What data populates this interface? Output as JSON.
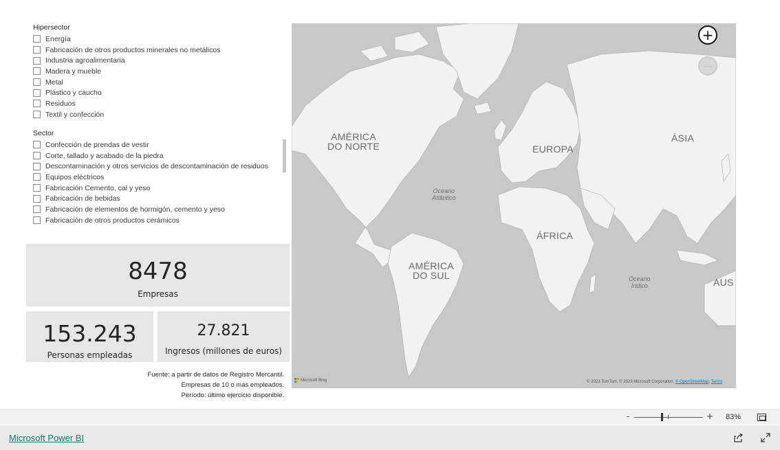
{
  "slicers": {
    "hipersector": {
      "title": "Hipersector",
      "items": [
        "Energía",
        "Fabricación de otros productos minerales no metálicos",
        "Industria agroalimentaria",
        "Madera y mueble",
        "Metal",
        "Plástico y caucho",
        "Residuos",
        "Textil y confección"
      ]
    },
    "sector": {
      "title": "Sector",
      "items": [
        "Confección de prendas de vestir",
        "Corte, tallado y acabado de la piedra",
        "Descontaminación y otros servicios de descontaminación de residuos",
        "Equipos eléctricos",
        "Fabricación Cemento, cal y yeso",
        "Fabricación de bebidas",
        "Fabricación de elementos de hormigón, cemento y yeso",
        "Fabricación de otros productos cerámicos"
      ]
    }
  },
  "kpis": {
    "empresas": {
      "value": "8478",
      "label": "Empresas"
    },
    "personas": {
      "value": "153.243",
      "label": "Personas empleadas"
    },
    "ingresos": {
      "value": "27.821",
      "label": "Ingresos (millones de euros)"
    }
  },
  "source_note": {
    "line1": "Fuente: a partir de datos de Registro Mercantil.",
    "line2": "Empresas de 10 o más empleados.",
    "line3": "Período: último ejercicio disponible."
  },
  "map": {
    "labels": {
      "north_america_1": "AMÉRICA",
      "north_america_2": "DO NORTE",
      "europe": "EUROPA",
      "asia": "ÁSIA",
      "africa": "ÁFRICA",
      "south_america_1": "AMÉRICA",
      "south_america_2": "DO SUL",
      "aus": "AUS",
      "atlantic_1": "Oceano",
      "atlantic_2": "Atlântico",
      "indian_1": "Oceano",
      "indian_2": "Índico"
    },
    "zoom_in": "+",
    "zoom_out": "−",
    "bing": "Microsoft Bing",
    "copyright": "© 2023 TomTom, © 2023 Microsoft Corporation,",
    "osm_link": "© OpenStreetMap",
    "terms_link": "Terms",
    "colors": {
      "water": "#c8c8c8",
      "land": "#f2f2f2"
    }
  },
  "zoombar": {
    "minus": "-",
    "plus": "+",
    "percent": "83%"
  },
  "footer": {
    "link": "Microsoft Power BI"
  }
}
